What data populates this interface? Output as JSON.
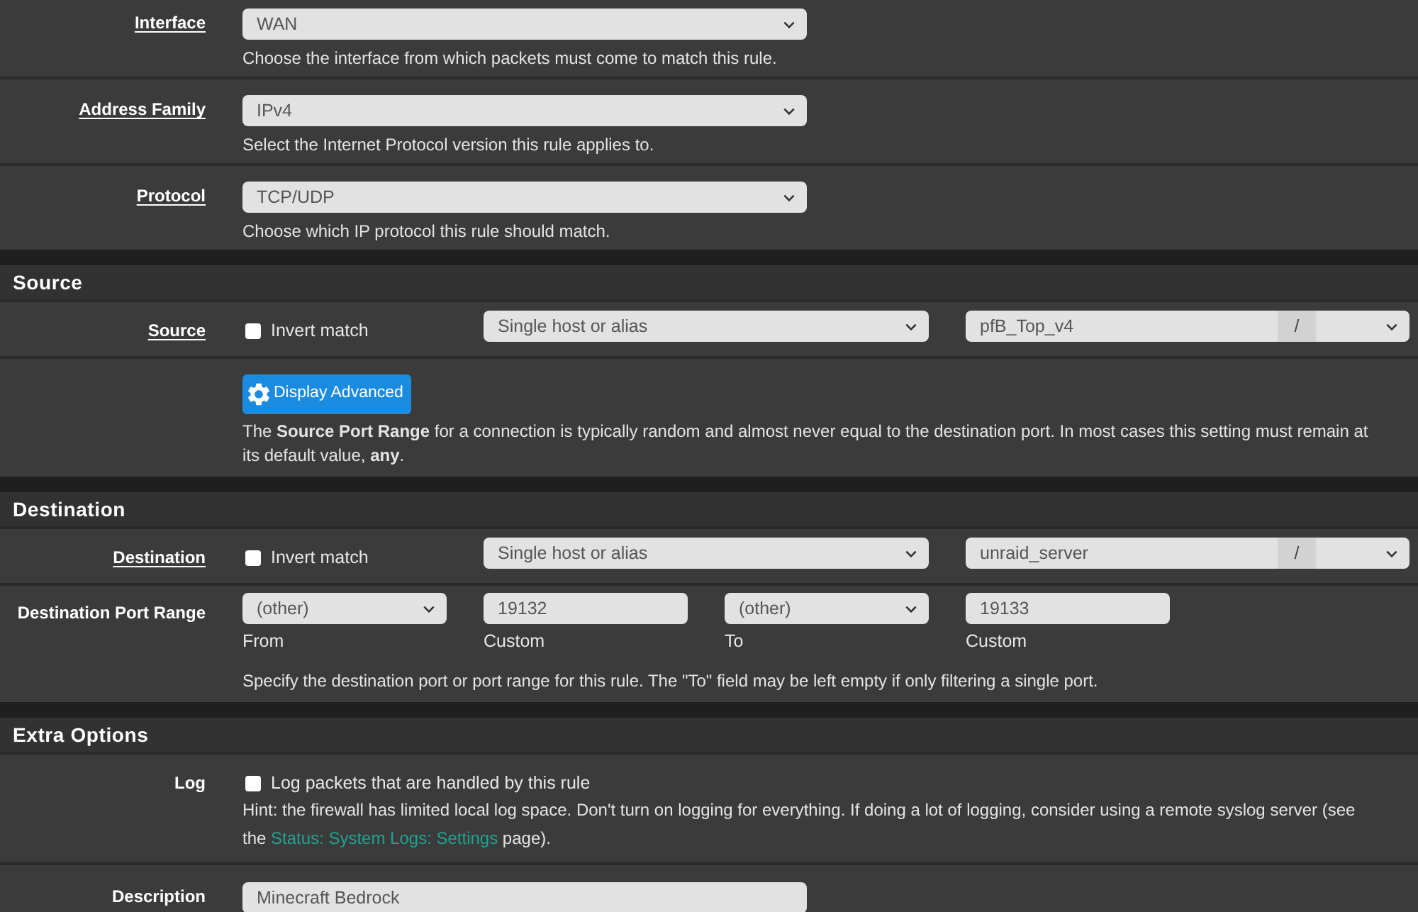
{
  "sections": [
    {
      "rows": [
        {
          "kind": "select",
          "label": "Interface",
          "label_link": true,
          "value": "WAN",
          "help": "Choose the interface from which packets must come to match this rule."
        },
        {
          "kind": "select",
          "label": "Address Family",
          "label_link": true,
          "value": "IPv4",
          "help": "Select the Internet Protocol version this rule applies to."
        },
        {
          "kind": "select",
          "label": "Protocol",
          "label_link": true,
          "value": "TCP/UDP",
          "help": "Choose which IP protocol this rule should match."
        }
      ]
    },
    {
      "title": "Source",
      "rows": [
        {
          "kind": "address",
          "label": "Source",
          "label_link": true,
          "invert": {
            "label": "Invert match",
            "checked": false
          },
          "type": "Single host or alias",
          "address": "pfB_Top_v4",
          "separator": "/"
        },
        {
          "kind": "advanced",
          "button": "Display Advanced",
          "help": "The **Source Port Range** for a connection is typically random and almost never equal to the destination port. In most cases this setting must remain at its default value, **any**."
        }
      ]
    },
    {
      "title": "Destination",
      "rows": [
        {
          "kind": "address",
          "label": "Destination",
          "label_link": true,
          "invert": {
            "label": "Invert match",
            "checked": false
          },
          "type": "Single host or alias",
          "address": "unraid_server",
          "separator": "/"
        },
        {
          "kind": "port_range",
          "label": "Destination Port Range",
          "label_link": false,
          "fields": [
            {
              "kind": "select",
              "value": "(other)",
              "caption": "From"
            },
            {
              "kind": "input",
              "value": "19132",
              "caption": "Custom"
            },
            {
              "kind": "select",
              "value": "(other)",
              "caption": "To"
            },
            {
              "kind": "input",
              "value": "19133",
              "caption": "Custom"
            }
          ],
          "help": "Specify the destination port or port range for this rule. The \"To\" field may be left empty if only filtering a single port."
        }
      ]
    },
    {
      "title": "Extra Options",
      "rows": [
        {
          "kind": "checkbox",
          "label": "Log",
          "label_link": false,
          "checkbox": {
            "label": "Log packets that are handled by this rule",
            "checked": false
          },
          "help_before": "Hint: the firewall has limited local log space. Don't turn on logging for everything. If doing a lot of logging, consider using a remote syslog server (see the ",
          "help_link": "Status: System Logs: Settings",
          "help_after": " page)."
        },
        {
          "kind": "text",
          "label": "Description",
          "label_link": false,
          "value": "Minecraft Bedrock"
        }
      ]
    }
  ]
}
